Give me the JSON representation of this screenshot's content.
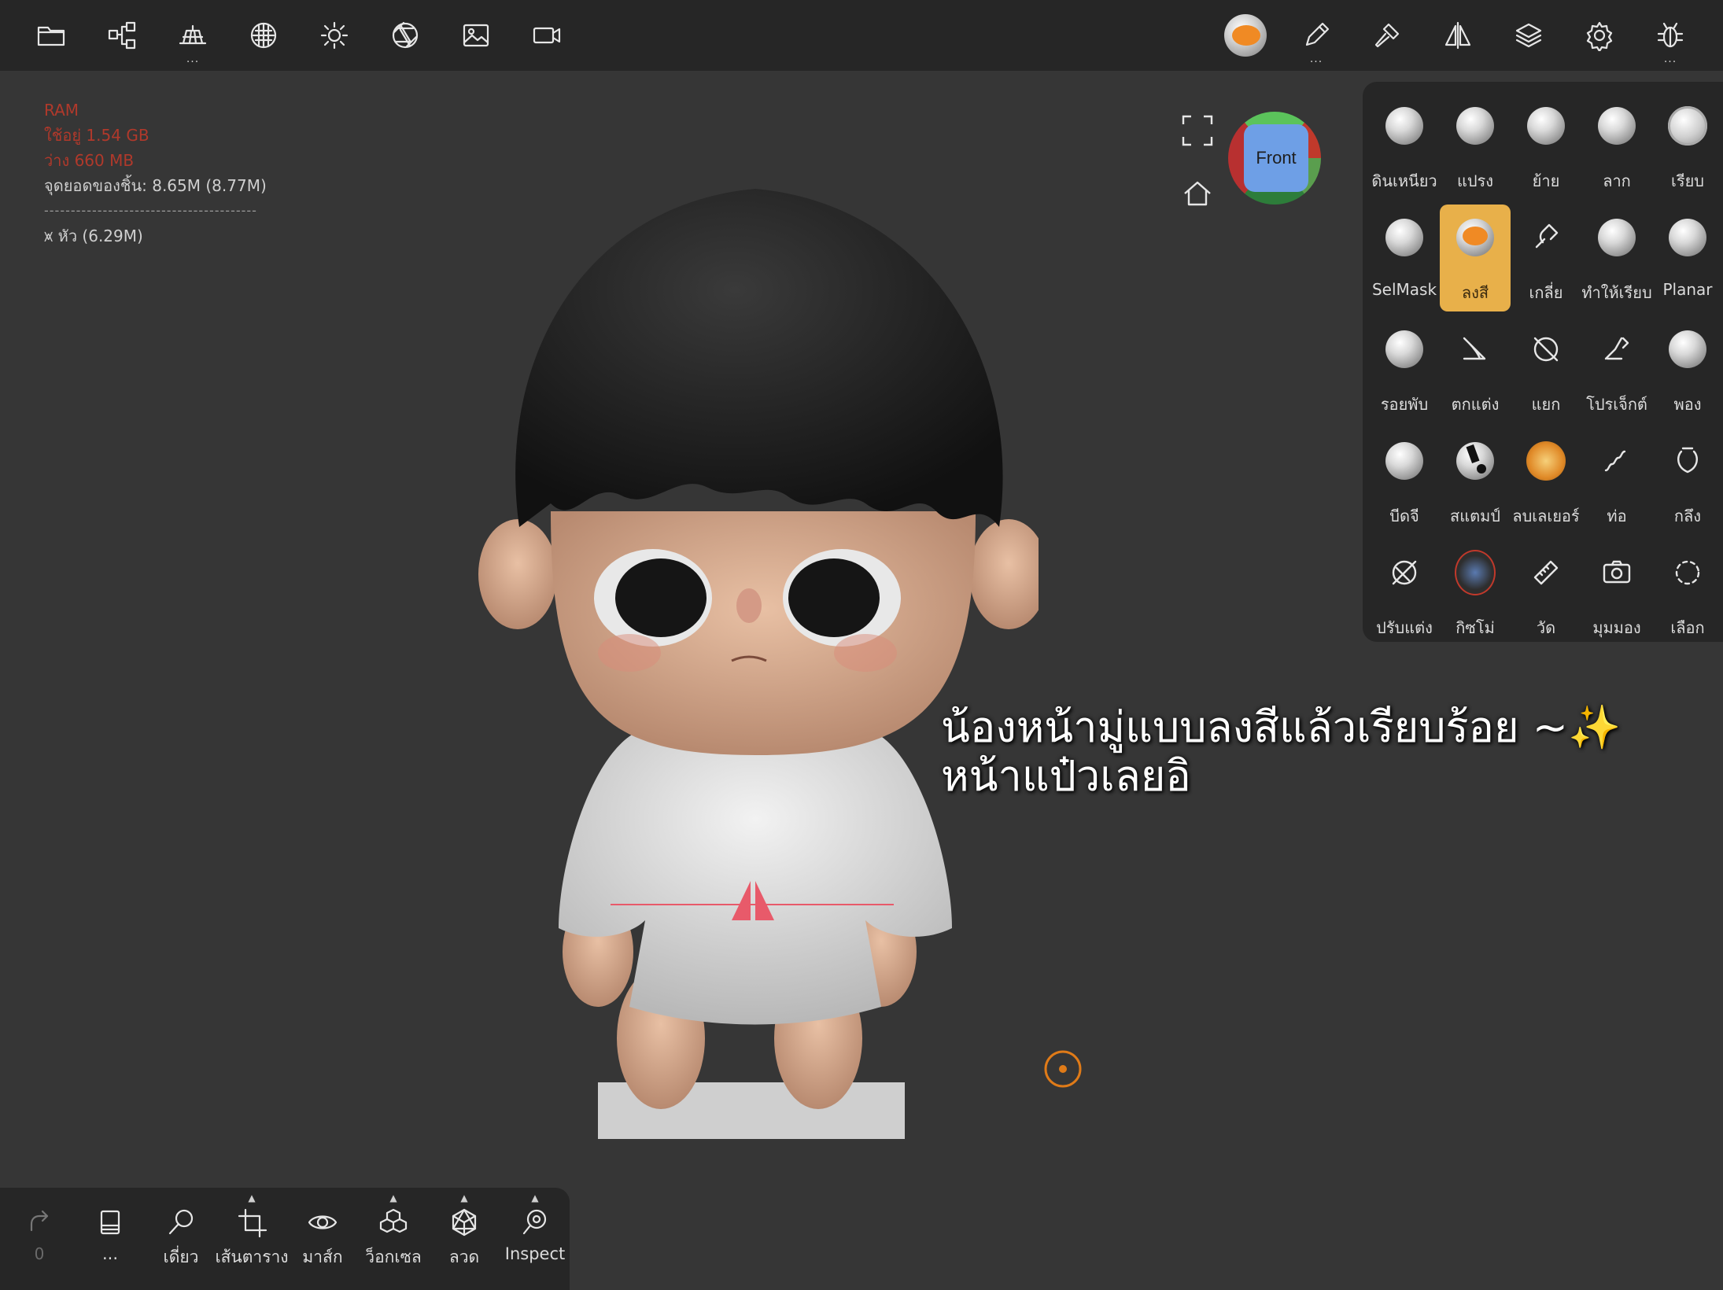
{
  "topbar": {
    "left_icons": [
      "folder-icon",
      "scene-graph-icon",
      "topology-icon",
      "matcap-icon",
      "light-icon",
      "aperture-icon",
      "image-icon",
      "video-icon"
    ],
    "right_icons": [
      "brush-sphere-icon",
      "pencil-icon",
      "hammer-icon",
      "symmetry-icon",
      "layers-icon",
      "settings-icon",
      "debug-icon"
    ],
    "more": "..."
  },
  "stats": {
    "ram_label": "RAM",
    "ram_used": "ใช้อยู่ 1.54 GB",
    "ram_free": "ว่าง 660 MB",
    "vertices": "จุดยอดของชิ้น: 8.65M (8.77M)",
    "separator": "----------------------------------------",
    "mesh": "หัว (6.29M)"
  },
  "gizmo": {
    "face": "Front"
  },
  "tools": [
    {
      "label": "ดินเหนียว",
      "icon": "clay-brush-icon"
    },
    {
      "label": "แปรง",
      "icon": "brush-tool-icon"
    },
    {
      "label": "ย้าย",
      "icon": "move-brush-icon"
    },
    {
      "label": "ลาก",
      "icon": "drag-brush-icon"
    },
    {
      "label": "เรียบ",
      "icon": "smooth-brush-icon"
    },
    {
      "label": "SelMask",
      "icon": "selmask-brush-icon"
    },
    {
      "label": "ลงสี",
      "icon": "paint-brush-icon",
      "active": true
    },
    {
      "label": "เกลี่ย",
      "icon": "smudge-icon"
    },
    {
      "label": "ทำให้เรียบ",
      "icon": "flatten-brush-icon"
    },
    {
      "label": "Planar",
      "icon": "planar-brush-icon"
    },
    {
      "label": "รอยพับ",
      "icon": "crease-brush-icon"
    },
    {
      "label": "ตกแต่ง",
      "icon": "trim-icon"
    },
    {
      "label": "แยก",
      "icon": "split-icon"
    },
    {
      "label": "โปรเจ็กต์",
      "icon": "project-icon"
    },
    {
      "label": "พอง",
      "icon": "inflate-brush-icon"
    },
    {
      "label": "บีดจี",
      "icon": "pinch-brush-icon"
    },
    {
      "label": "สแตมป์",
      "icon": "stamp-brush-icon"
    },
    {
      "label": "ลบเลเยอร์",
      "icon": "layer-erase-icon"
    },
    {
      "label": "ท่อ",
      "icon": "tube-icon"
    },
    {
      "label": "กลึง",
      "icon": "lathe-icon"
    },
    {
      "label": "ปรับแต่ง",
      "icon": "transform-icon"
    },
    {
      "label": "กิซโม่",
      "icon": "gizmo-icon"
    },
    {
      "label": "วัด",
      "icon": "ruler-icon"
    },
    {
      "label": "มุมมอง",
      "icon": "camera-icon"
    },
    {
      "label": "เลือก",
      "icon": "select-icon"
    }
  ],
  "bottombar": {
    "redo_count": "0",
    "items": [
      {
        "label": "...",
        "icon": "history-icon"
      },
      {
        "label": "เดี่ยว",
        "icon": "solo-search-icon"
      },
      {
        "label": "เส้นตาราง",
        "icon": "grid-crop-icon"
      },
      {
        "label": "มาส์ก",
        "icon": "eye-mask-icon"
      },
      {
        "label": "ว็อกเซล",
        "icon": "voxel-icon"
      },
      {
        "label": "ลวด",
        "icon": "wireframe-icon"
      },
      {
        "label": "Inspect",
        "icon": "inspect-icon"
      }
    ]
  },
  "caption": {
    "line1": "น้องหน้ามู่แบบลงสีแล้วเรียบร้อย ~✨",
    "line2": "หน้าแป๋วเลยอิ"
  },
  "colors": {
    "accent": "#e8b04a",
    "panel": "#262626",
    "viewport": "#363636",
    "stats_red": "#b0392b"
  }
}
